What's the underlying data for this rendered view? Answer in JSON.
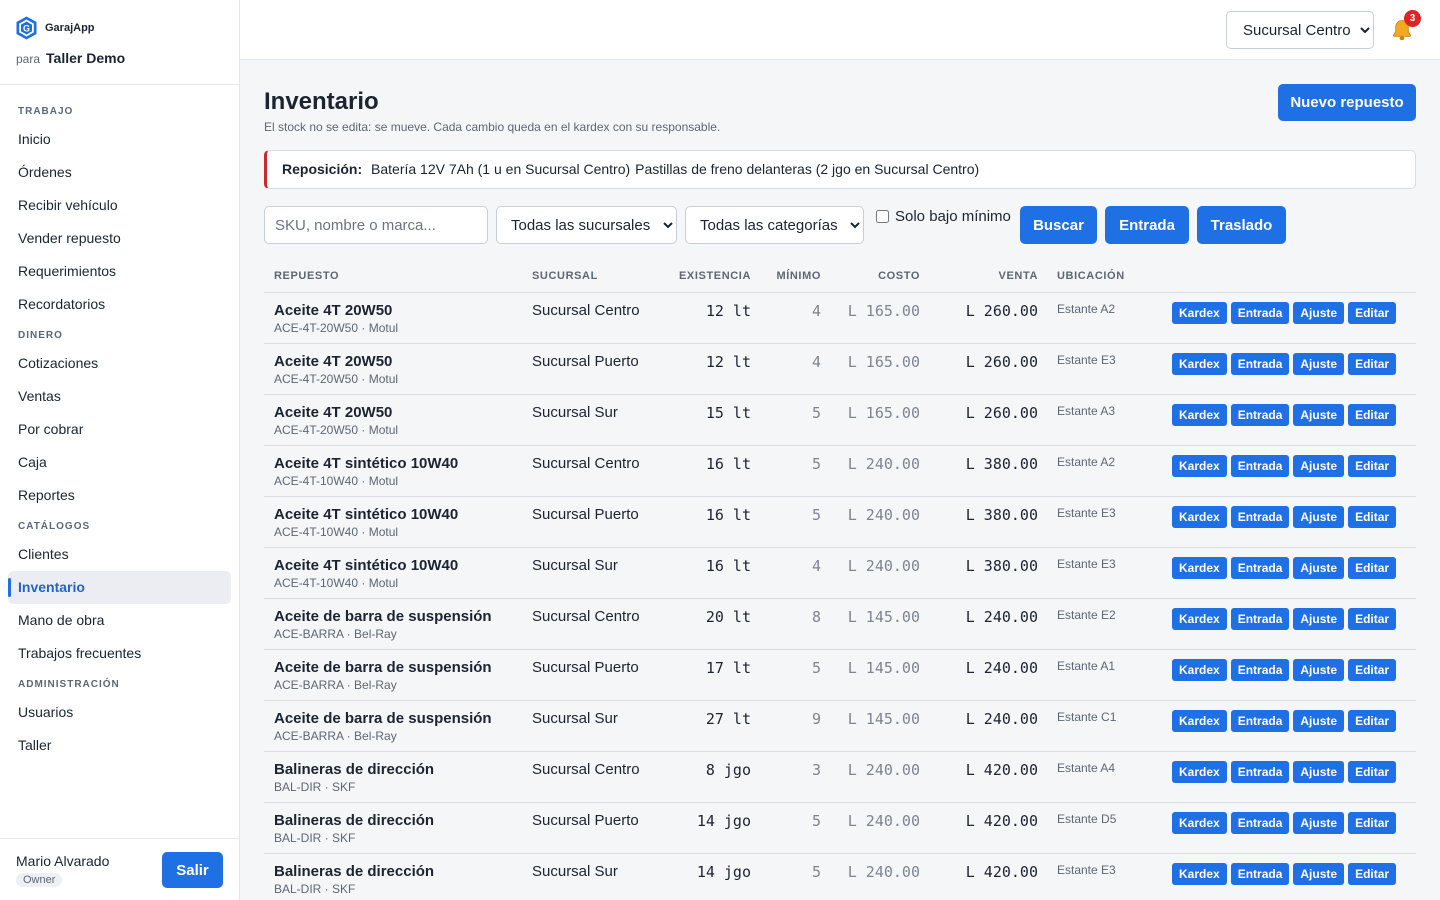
{
  "brand": {
    "name": "GarajApp",
    "para": "para",
    "taller": "Taller Demo"
  },
  "sidebar": {
    "sections": [
      {
        "label": "TRABAJO",
        "items": [
          "Inicio",
          "Órdenes",
          "Recibir vehículo",
          "Vender repuesto",
          "Requerimientos",
          "Recordatorios"
        ]
      },
      {
        "label": "DINERO",
        "items": [
          "Cotizaciones",
          "Ventas",
          "Por cobrar",
          "Caja",
          "Reportes"
        ]
      },
      {
        "label": "CATÁLOGOS",
        "items": [
          "Clientes",
          "Inventario",
          "Mano de obra",
          "Trabajos frecuentes"
        ]
      },
      {
        "label": "ADMINISTRACIÓN",
        "items": [
          "Usuarios",
          "Taller"
        ]
      }
    ],
    "active": "Inventario"
  },
  "user": {
    "name": "Mario Alvarado",
    "role": "Owner",
    "logout_label": "Salir"
  },
  "topbar": {
    "branch_selected": "Sucursal Centro",
    "notifications_count": "3"
  },
  "page": {
    "title": "Inventario",
    "subtitle": "El stock no se edita: se mueve. Cada cambio queda en el kardex con su responsable.",
    "new_button": "Nuevo repuesto"
  },
  "alert": {
    "label": "Reposición:",
    "items": [
      "Batería 12V 7Ah (1 u en Sucursal Centro)",
      "Pastillas de freno delanteras (2 jgo en Sucursal Centro)"
    ]
  },
  "filters": {
    "search_placeholder": "SKU, nombre o marca...",
    "branch_filter": "Todas las sucursales",
    "category_filter": "Todas las categorías",
    "below_min_label": "Solo bajo mínimo",
    "search_button": "Buscar",
    "entrada_button": "Entrada",
    "traslado_button": "Traslado"
  },
  "table": {
    "columns": [
      "REPUESTO",
      "SUCURSAL",
      "EXISTENCIA",
      "MÍNIMO",
      "COSTO",
      "VENTA",
      "UBICACIÓN"
    ],
    "action_labels": [
      "Kardex",
      "Entrada",
      "Ajuste",
      "Editar"
    ],
    "rows": [
      {
        "name": "Aceite 4T 20W50",
        "sku": "ACE-4T-20W50 · Motul",
        "sucursal": "Sucursal Centro",
        "existencia": "12 lt",
        "minimo": "4",
        "costo": "L 165.00",
        "venta": "L 260.00",
        "ubicacion": "Estante A2"
      },
      {
        "name": "Aceite 4T 20W50",
        "sku": "ACE-4T-20W50 · Motul",
        "sucursal": "Sucursal Puerto",
        "existencia": "12 lt",
        "minimo": "4",
        "costo": "L 165.00",
        "venta": "L 260.00",
        "ubicacion": "Estante E3"
      },
      {
        "name": "Aceite 4T 20W50",
        "sku": "ACE-4T-20W50 · Motul",
        "sucursal": "Sucursal Sur",
        "existencia": "15 lt",
        "minimo": "5",
        "costo": "L 165.00",
        "venta": "L 260.00",
        "ubicacion": "Estante A3"
      },
      {
        "name": "Aceite 4T sintético 10W40",
        "sku": "ACE-4T-10W40 · Motul",
        "sucursal": "Sucursal Centro",
        "existencia": "16 lt",
        "minimo": "5",
        "costo": "L 240.00",
        "venta": "L 380.00",
        "ubicacion": "Estante A2"
      },
      {
        "name": "Aceite 4T sintético 10W40",
        "sku": "ACE-4T-10W40 · Motul",
        "sucursal": "Sucursal Puerto",
        "existencia": "16 lt",
        "minimo": "5",
        "costo": "L 240.00",
        "venta": "L 380.00",
        "ubicacion": "Estante E3"
      },
      {
        "name": "Aceite 4T sintético 10W40",
        "sku": "ACE-4T-10W40 · Motul",
        "sucursal": "Sucursal Sur",
        "existencia": "16 lt",
        "minimo": "4",
        "costo": "L 240.00",
        "venta": "L 380.00",
        "ubicacion": "Estante E3"
      },
      {
        "name": "Aceite de barra de suspensión",
        "sku": "ACE-BARRA · Bel-Ray",
        "sucursal": "Sucursal Centro",
        "existencia": "20 lt",
        "minimo": "8",
        "costo": "L 145.00",
        "venta": "L 240.00",
        "ubicacion": "Estante E2"
      },
      {
        "name": "Aceite de barra de suspensión",
        "sku": "ACE-BARRA · Bel-Ray",
        "sucursal": "Sucursal Puerto",
        "existencia": "17 lt",
        "minimo": "5",
        "costo": "L 145.00",
        "venta": "L 240.00",
        "ubicacion": "Estante A1"
      },
      {
        "name": "Aceite de barra de suspensión",
        "sku": "ACE-BARRA · Bel-Ray",
        "sucursal": "Sucursal Sur",
        "existencia": "27 lt",
        "minimo": "9",
        "costo": "L 145.00",
        "venta": "L 240.00",
        "ubicacion": "Estante C1"
      },
      {
        "name": "Balineras de dirección",
        "sku": "BAL-DIR · SKF",
        "sucursal": "Sucursal Centro",
        "existencia": "8 jgo",
        "minimo": "3",
        "costo": "L 240.00",
        "venta": "L 420.00",
        "ubicacion": "Estante A4"
      },
      {
        "name": "Balineras de dirección",
        "sku": "BAL-DIR · SKF",
        "sucursal": "Sucursal Puerto",
        "existencia": "14 jgo",
        "minimo": "5",
        "costo": "L 240.00",
        "venta": "L 420.00",
        "ubicacion": "Estante D5"
      },
      {
        "name": "Balineras de dirección",
        "sku": "BAL-DIR · SKF",
        "sucursal": "Sucursal Sur",
        "existencia": "14 jgo",
        "minimo": "5",
        "costo": "L 240.00",
        "venta": "L 420.00",
        "ubicacion": "Estante E3"
      }
    ]
  },
  "colors": {
    "accent": "#1f6fe5",
    "alert_border": "#c92a2a",
    "badge": "#e02424"
  },
  "icons": {
    "logo": "hexagon-g-logo-icon",
    "notifications": "bell-icon"
  }
}
